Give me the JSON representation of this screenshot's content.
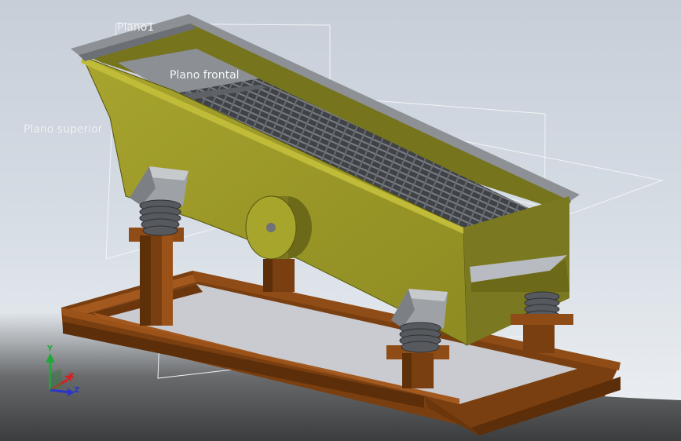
{
  "viewport": {
    "planes": [
      {
        "id": "plano1",
        "label": "Plano1"
      },
      {
        "id": "plano-frontal",
        "label": "Plano frontal"
      },
      {
        "id": "plano-superior",
        "label": "Plano superior"
      }
    ],
    "triad": {
      "x_label": "X",
      "y_label": "Y",
      "z_label": "Z",
      "x_color": "#d42020",
      "y_color": "#22a83a",
      "z_color": "#2a36c8"
    }
  },
  "colors": {
    "body": "#9d9a2a",
    "body_dark": "#6e6b1a",
    "frame": "#8a4a14",
    "frame_dark": "#5e300a",
    "screen": "#4a4d52",
    "spring": "#55585c",
    "bracket": "#9a9da2"
  }
}
